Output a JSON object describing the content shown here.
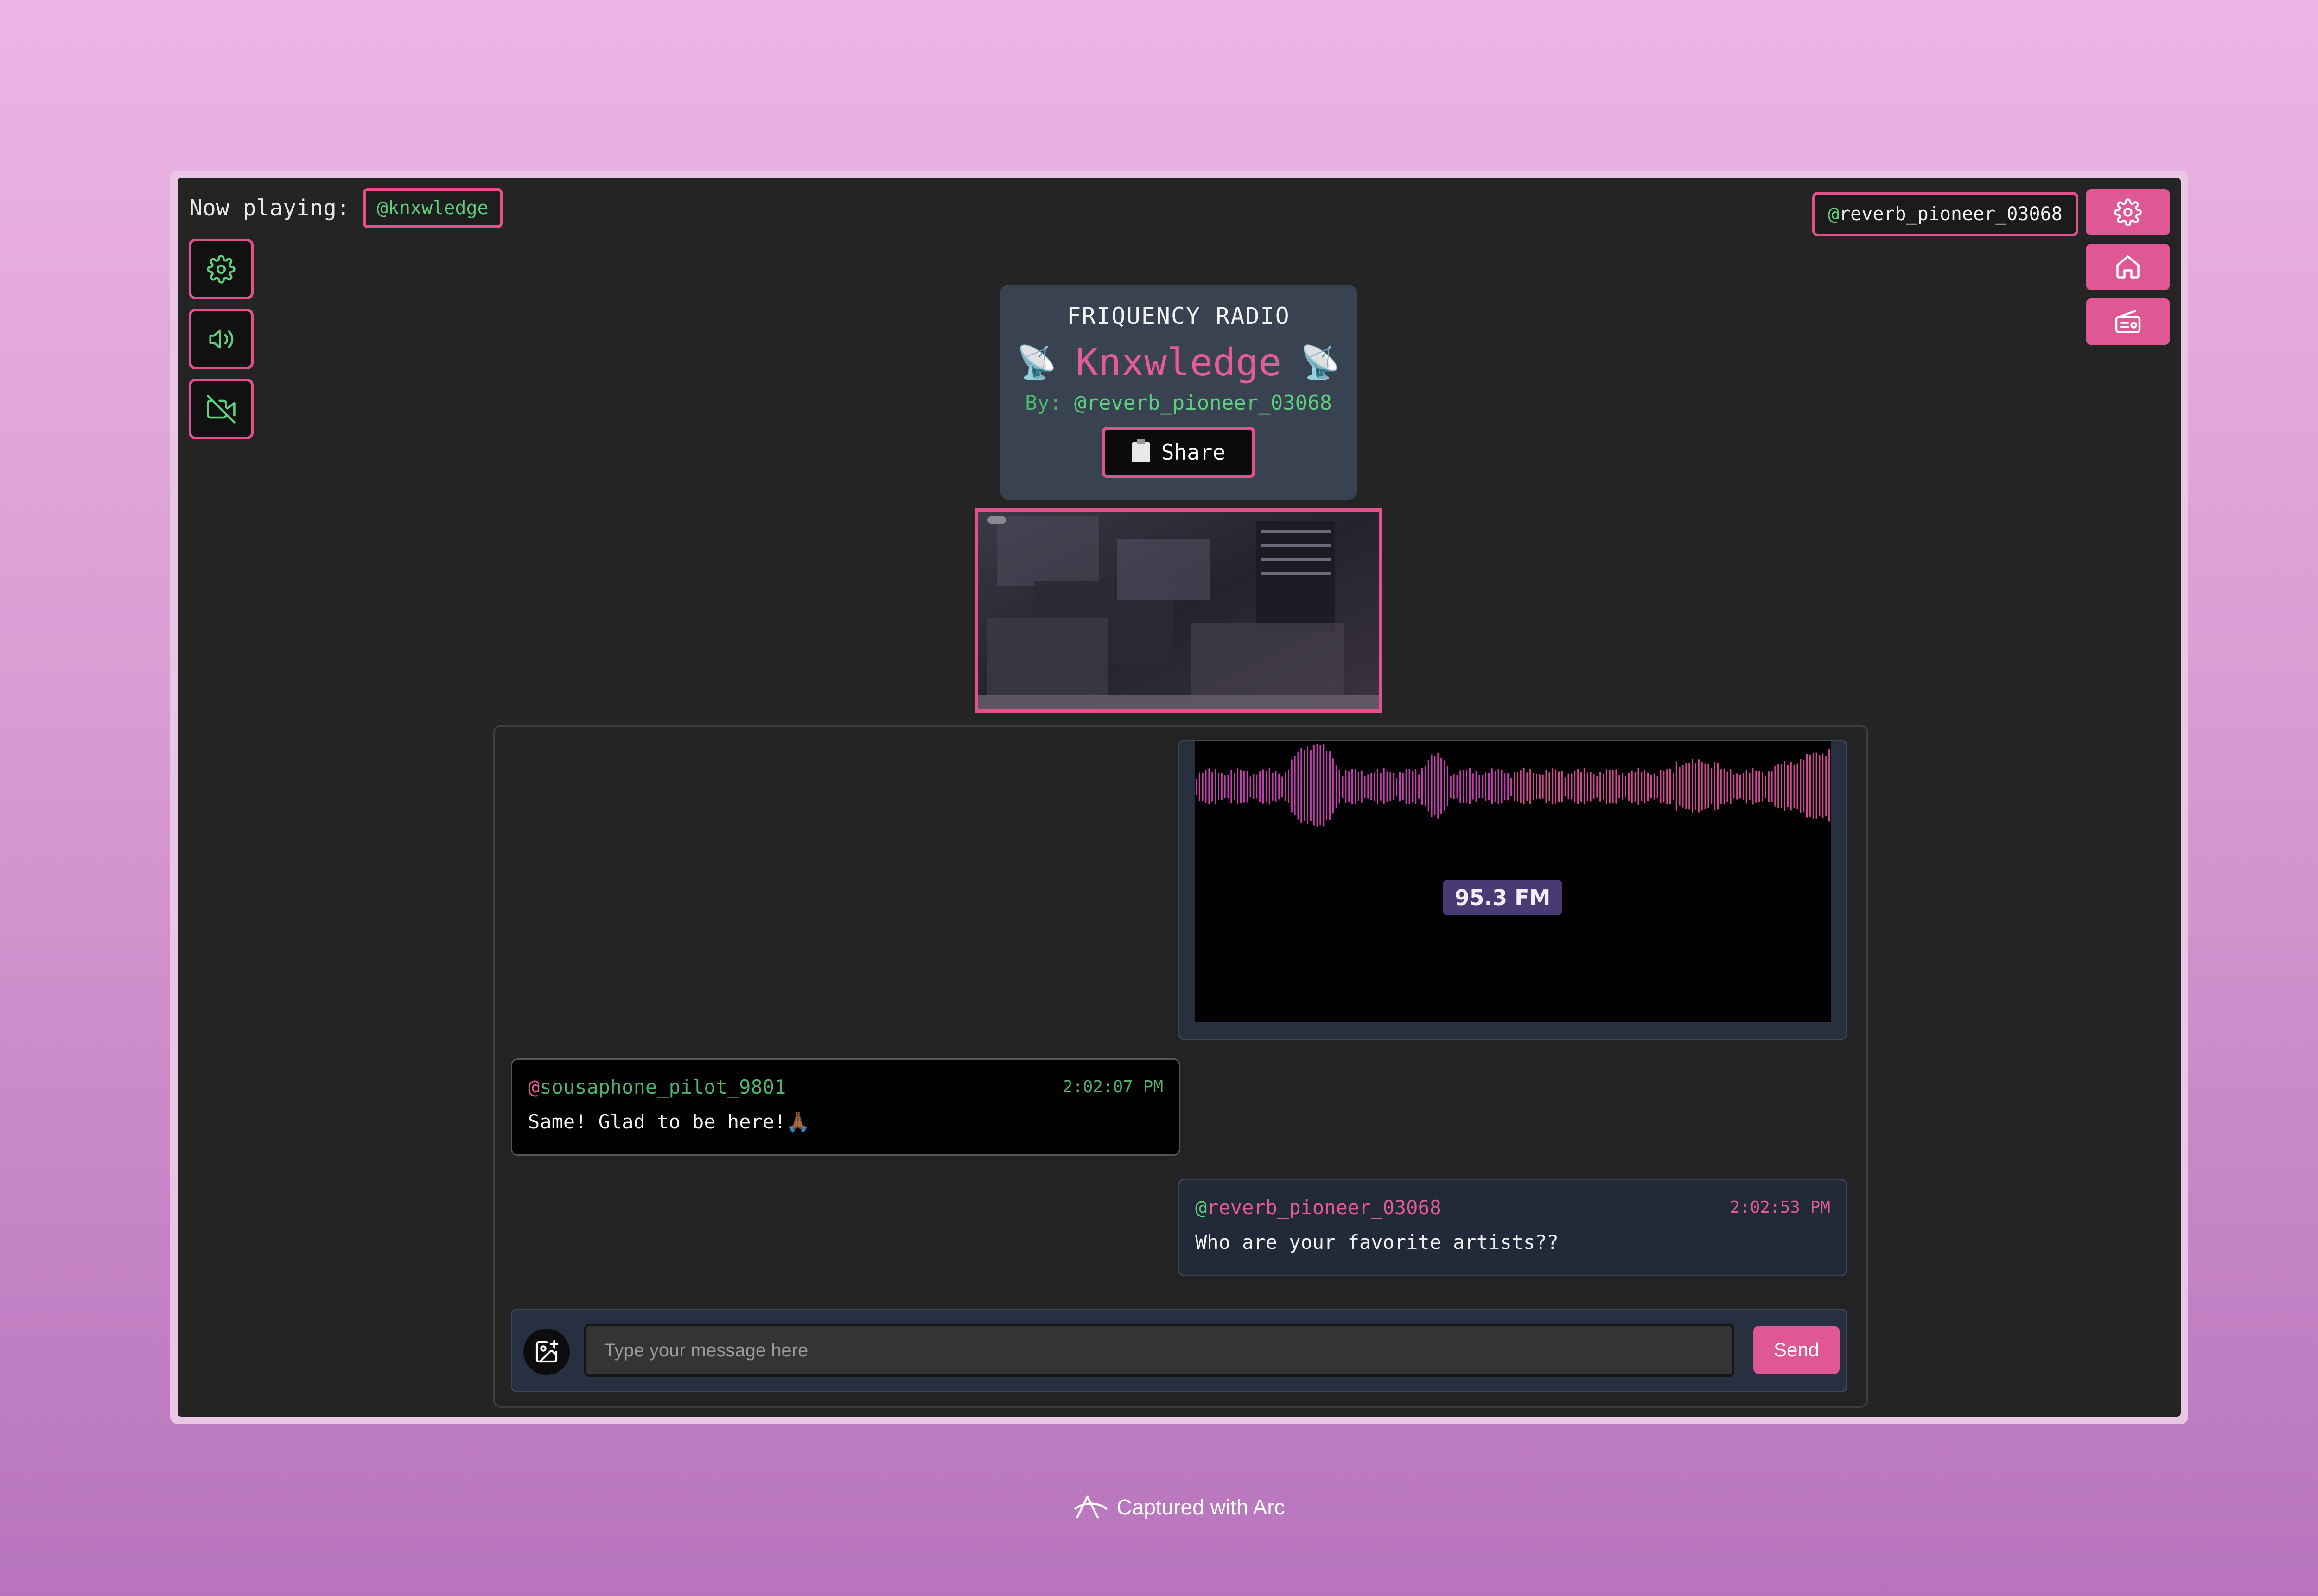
{
  "header": {
    "now_playing_label": "Now playing:",
    "now_playing_handle": "@knxwledge",
    "current_user_at": "@",
    "current_user_name": "reverb_pioneer_03068"
  },
  "left_toolbar": {
    "items": [
      {
        "icon": "gear-icon"
      },
      {
        "icon": "speaker-icon"
      },
      {
        "icon": "video-off-icon"
      }
    ]
  },
  "right_toolbar": {
    "items": [
      {
        "icon": "gear-icon"
      },
      {
        "icon": "home-icon"
      },
      {
        "icon": "radio-icon"
      }
    ]
  },
  "station": {
    "brand": "FRIQUENCY RADIO",
    "name": "Knxwledge",
    "emoji": "📡",
    "by_label": "By:",
    "by_handle": "@reverb_pioneer_03068",
    "share_label": "Share"
  },
  "chat": {
    "media_message": {
      "badge": "95.3 FM"
    },
    "messages": [
      {
        "at": "@",
        "user": "sousaphone_pilot_9801",
        "time": "2:02:07 PM",
        "text": "Same! Glad to be here!🙏🏾"
      },
      {
        "at": "@",
        "user": "reverb_pioneer_03068",
        "time": "2:02:53 PM",
        "text": "Who are your favorite artists??"
      }
    ],
    "composer": {
      "placeholder": "Type your message here",
      "value": "",
      "send_label": "Send"
    }
  },
  "footer": {
    "text": "Captured with Arc"
  },
  "colors": {
    "accent_pink": "#e4508e",
    "accent_green": "#5ecf7e",
    "window_bg": "#242424",
    "card_bg": "#394250"
  }
}
